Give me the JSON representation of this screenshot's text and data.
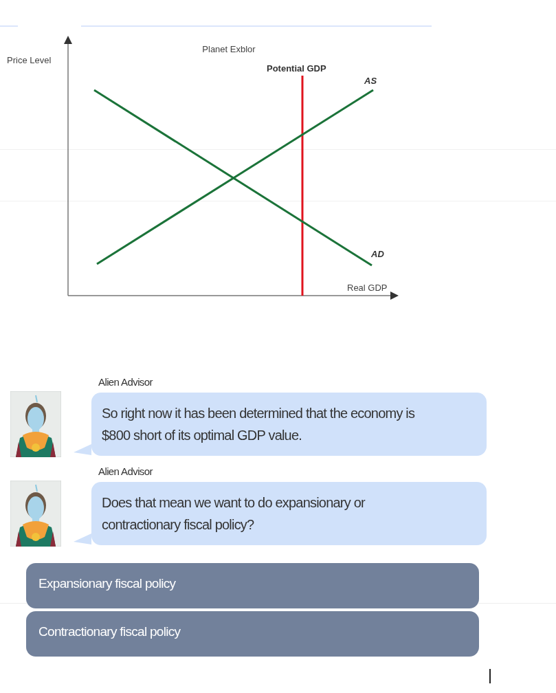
{
  "graph": {
    "title": "Planet Exblor",
    "y_axis_label": "Price Level",
    "x_axis_label": "Real GDP",
    "vertical_line_label": "Potential GDP",
    "curve_labels": [
      "AS",
      "AD"
    ]
  },
  "messages": [
    {
      "sender": "Alien Advisor",
      "text": "So right now it has been determined that the economy is $800 short of its optimal GDP value."
    },
    {
      "sender": "Alien Advisor",
      "text": "Does that mean we want to do expansionary or contractionary fiscal policy?"
    }
  ],
  "choices": [
    "Expansionary fiscal policy",
    "Contractionary fiscal policy"
  ]
}
